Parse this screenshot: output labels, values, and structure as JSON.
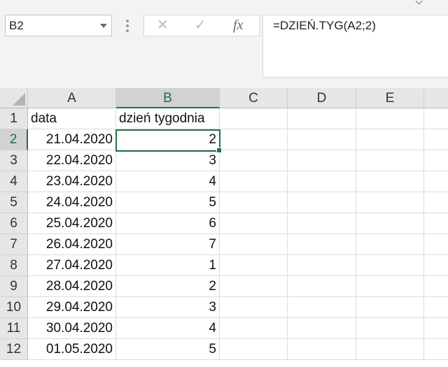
{
  "name_box": {
    "value": "B2"
  },
  "formula_bar": {
    "value": "=DZIEŃ.TYG(A2;2)",
    "fx_label": "fx"
  },
  "icons": [
    "cancel-icon",
    "enter-icon",
    "function-icon",
    "dropdown-icon"
  ],
  "accent_color": "#217346",
  "columns": [
    "A",
    "B",
    "C",
    "D",
    "E"
  ],
  "selected_column": "B",
  "selected_row": "2",
  "rows": [
    {
      "num": "1",
      "a": "data",
      "b": "dzień tygodnia"
    },
    {
      "num": "2",
      "a": "21.04.2020",
      "b": "2"
    },
    {
      "num": "3",
      "a": "22.04.2020",
      "b": "3"
    },
    {
      "num": "4",
      "a": "23.04.2020",
      "b": "4"
    },
    {
      "num": "5",
      "a": "24.04.2020",
      "b": "5"
    },
    {
      "num": "6",
      "a": "25.04.2020",
      "b": "6"
    },
    {
      "num": "7",
      "a": "26.04.2020",
      "b": "7"
    },
    {
      "num": "8",
      "a": "27.04.2020",
      "b": "1"
    },
    {
      "num": "9",
      "a": "28.04.2020",
      "b": "2"
    },
    {
      "num": "10",
      "a": "29.04.2020",
      "b": "3"
    },
    {
      "num": "11",
      "a": "30.04.2020",
      "b": "4"
    },
    {
      "num": "12",
      "a": "01.05.2020",
      "b": "5"
    }
  ]
}
